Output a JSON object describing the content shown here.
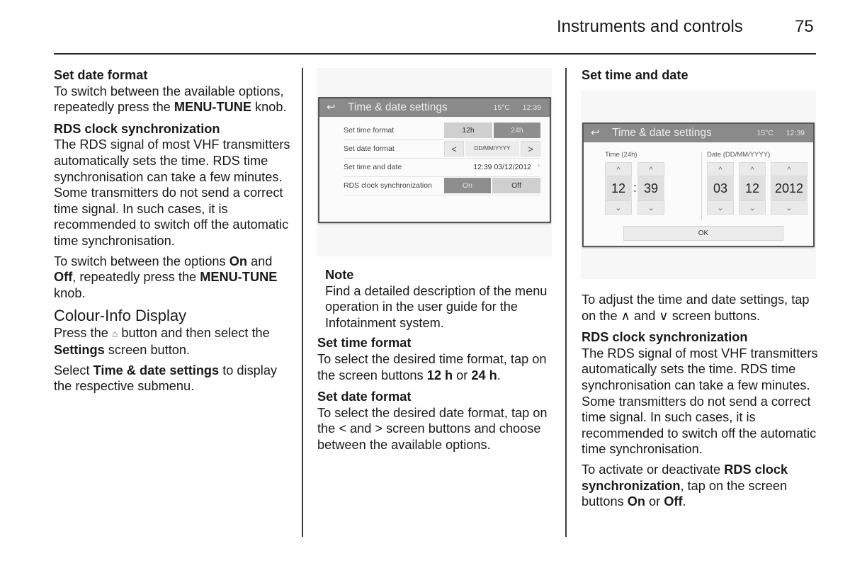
{
  "header": {
    "section_title": "Instruments and controls",
    "page_number": "75"
  },
  "col1": {
    "set_date_format_heading": "Set date format",
    "set_date_format_text_1": "To switch between the available options, repeatedly press the ",
    "menu_tune_1": "MENU-TUNE",
    "set_date_format_text_2": " knob.",
    "rds_heading": "RDS clock synchronization",
    "rds_text": "The RDS signal of most VHF transmitters automatically sets the time. RDS time synchronisation can take a few minutes. Some transmitters do not send a correct time signal. In such cases, it is recommended to switch off the automatic time synchronisation.",
    "switch_text_1": "To switch between the options ",
    "on_label": "On",
    "switch_text_2": " and ",
    "off_label": "Off",
    "switch_text_3": ", repeatedly press the ",
    "menu_tune_2": "MENU-TUNE",
    "switch_text_4": " knob.",
    "colour_heading": "Colour-Info Display",
    "press_text_1": "Press the ",
    "home_icon_glyph": "⌂",
    "press_text_2": " button and then select the ",
    "settings_label": "Settings",
    "press_text_3": " screen button.",
    "select_text_1": "Select ",
    "time_date_settings_label": "Time & date settings",
    "select_text_2": " to display the respective submenu."
  },
  "screen1": {
    "back_icon": "↩",
    "title": "Time & date settings",
    "temperature": "15°C",
    "clock": "12:39",
    "rows": [
      {
        "label": "Set time format",
        "options": [
          "12h",
          "24h"
        ],
        "selected": "12h"
      },
      {
        "label": "Set date format",
        "prev": "<",
        "value": "DD/MM/YYYY",
        "next": ">"
      },
      {
        "label": "Set time and date",
        "value": "12:39  03/12/2012",
        "chevron": "›"
      },
      {
        "label": "RDS clock synchronization",
        "options": [
          "On",
          "Off"
        ],
        "selected": "Off"
      }
    ]
  },
  "col2": {
    "note_heading": "Note",
    "note_text": "Find a detailed description of the menu operation in the user guide for the Infotainment system.",
    "set_time_format_heading": "Set time format",
    "set_time_format_text_1": "To select the desired time format, tap on the screen buttons ",
    "h12_label": "12 h",
    "set_time_format_or": " or ",
    "h24_label": "24 h",
    "set_time_format_end": ".",
    "set_date_format_heading": "Set date format",
    "set_date_format_text": "To select the desired date format, tap on the < and > screen buttons and choose between the available options."
  },
  "screen2": {
    "back_icon": "↩",
    "title": "Time & date settings",
    "temperature": "15°C",
    "clock": "12:39",
    "time_label": "Time (24h)",
    "date_label": "Date (DD/MM/YYYY)",
    "up_glyph": "^",
    "down_glyph": "⌄",
    "hour": "12",
    "minute": "39",
    "colon": ":",
    "day": "03",
    "month": "12",
    "year": "2012",
    "ok_label": "OK"
  },
  "col3": {
    "set_time_date_heading": "Set time and date",
    "adjust_text_1": "To adjust the time and date settings, tap on the ",
    "up_icon": "∧",
    "adjust_and": " and ",
    "down_icon": "∨",
    "adjust_text_2": " screen buttons.",
    "rds_heading": "RDS clock synchronization",
    "rds_text": "The RDS signal of most VHF transmitters automatically sets the time. RDS time synchronisation can take a few minutes. Some transmitters do not send a correct time signal. In such cases, it is recommended to switch off the automatic time synchronisation.",
    "activate_text_1": "To activate or deactivate ",
    "rds_bold": "RDS clock synchronization",
    "activate_text_2": ", tap on the screen buttons ",
    "on_label": "On",
    "activate_or": " or ",
    "off_label": "Off",
    "activate_end": "."
  }
}
